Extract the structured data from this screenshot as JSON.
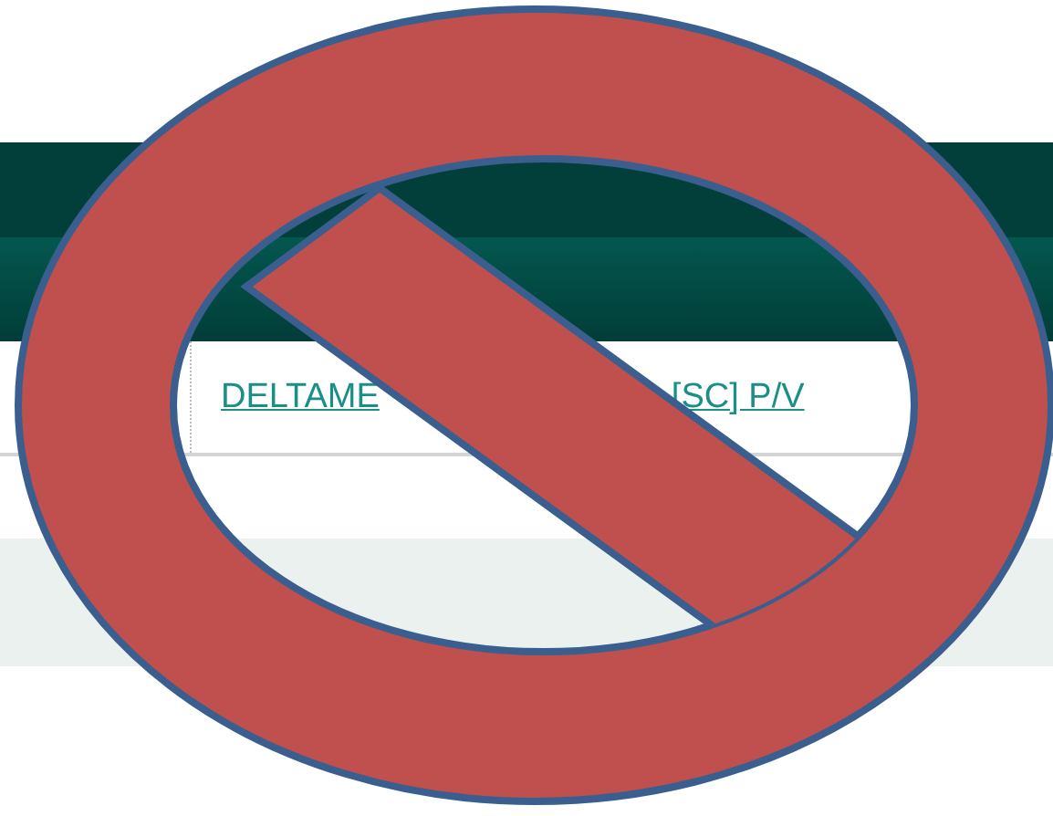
{
  "table": {
    "link_parts": [
      "DELTAME",
      "[SC] P/V"
    ]
  }
}
